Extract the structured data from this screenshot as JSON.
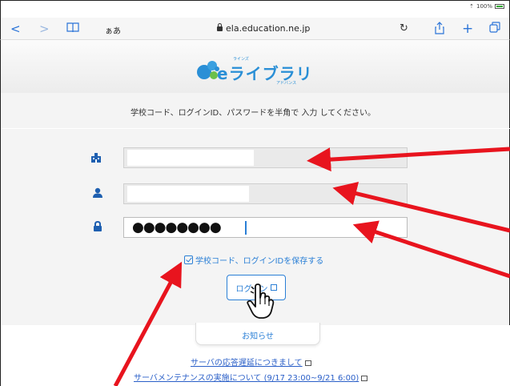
{
  "status_bar": {
    "signal": "⇡",
    "battery_percent": "100%"
  },
  "browser": {
    "back_glyph": "<",
    "forward_glyph": ">",
    "bookmarks_icon": "book-icon",
    "aa_label": "ぁあ",
    "url": "ela.education.ne.jp",
    "reload_glyph": "↻",
    "share_glyph": "⇧",
    "new_tab_glyph": "+",
    "tabs_glyph": "⧉"
  },
  "logo": {
    "word": "eライブラリ",
    "sub_top": "ラインズ",
    "sub_bottom": "アドバンス"
  },
  "login": {
    "instruction": "学校コード、ログインID、パスワードを半角で 入力 してください。",
    "school_code_value": "",
    "login_id_value": "",
    "password_mask": "●●●●●●●●",
    "save_label": "学校コード、ログインIDを保存する",
    "save_checked": true,
    "login_button_label": "ログイン"
  },
  "news": {
    "title": "お知らせ",
    "items": [
      {
        "label": "サーバの応答遅延につきまして"
      },
      {
        "label": "サーバメンテナンスの実施について (9/17 23:00~9/21 6:00)"
      }
    ]
  },
  "colors": {
    "accent": "#2a7fd6",
    "field_icon": "#1e5fb0",
    "annotation": "#e8141e"
  }
}
